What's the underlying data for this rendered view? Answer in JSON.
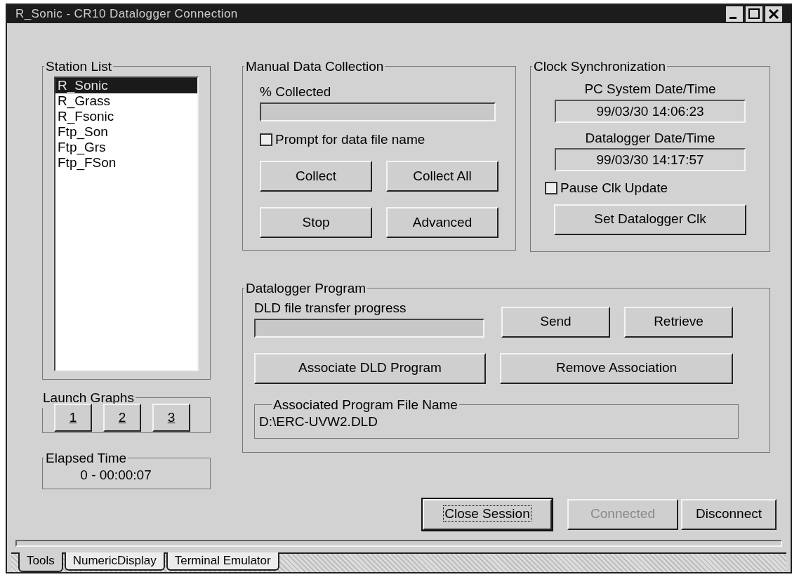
{
  "window": {
    "title": "R_Sonic - CR10 Datalogger Connection"
  },
  "station_list": {
    "title": "Station List",
    "items": [
      {
        "label": "R_Sonic",
        "selected": true
      },
      {
        "label": "R_Grass",
        "selected": false
      },
      {
        "label": "R_Fsonic",
        "selected": false
      },
      {
        "label": "Ftp_Son",
        "selected": false
      },
      {
        "label": "Ftp_Grs",
        "selected": false
      },
      {
        "label": "Ftp_FSon",
        "selected": false
      }
    ]
  },
  "launch_graphs": {
    "title": "Launch Graphs",
    "buttons": [
      "1",
      "2",
      "3"
    ]
  },
  "elapsed_time": {
    "title": "Elapsed Time",
    "value": "0 - 00:00:07"
  },
  "manual_data_collection": {
    "title": "Manual Data Collection",
    "progress_label": "% Collected",
    "progress": {
      "level": 0
    },
    "prompt_checkbox": {
      "label": "Prompt for data file name",
      "checked": false
    },
    "buttons": [
      "Collect",
      "Collect All",
      "Stop",
      "Advanced"
    ]
  },
  "clock_synchronization": {
    "title": "Clock Synchronization",
    "pc_label": "PC System Date/Time",
    "pc_value": "99/03/30 14:06:23",
    "logger_label": "Datalogger Date/Time",
    "logger_value": "99/03/30 14:17:57",
    "pause_checkbox": {
      "label": "Pause Clk Update",
      "checked": false
    },
    "set_button": "Set Datalogger Clk"
  },
  "datalogger_program": {
    "title": "Datalogger Program",
    "progress_label": "DLD file transfer progress",
    "progress": {
      "level": 0
    },
    "buttons": [
      "Send",
      "Retrieve",
      "Associate DLD Program",
      "Remove Association"
    ],
    "file_name": {
      "title": "Associated Program File Name",
      "value": "D:\\ERC-UVW2.DLD"
    }
  },
  "session_buttons": [
    {
      "label": "Close Session",
      "focused": true,
      "disabled": false
    },
    {
      "label": "Connected",
      "focused": false,
      "disabled": true
    },
    {
      "label": "Disconnect",
      "focused": false,
      "disabled": false
    }
  ],
  "tabs": [
    {
      "label": "Tools",
      "selected": true
    },
    {
      "label": "NumericDisplay",
      "selected": false
    },
    {
      "label": "Terminal Emulator",
      "selected": false
    }
  ]
}
